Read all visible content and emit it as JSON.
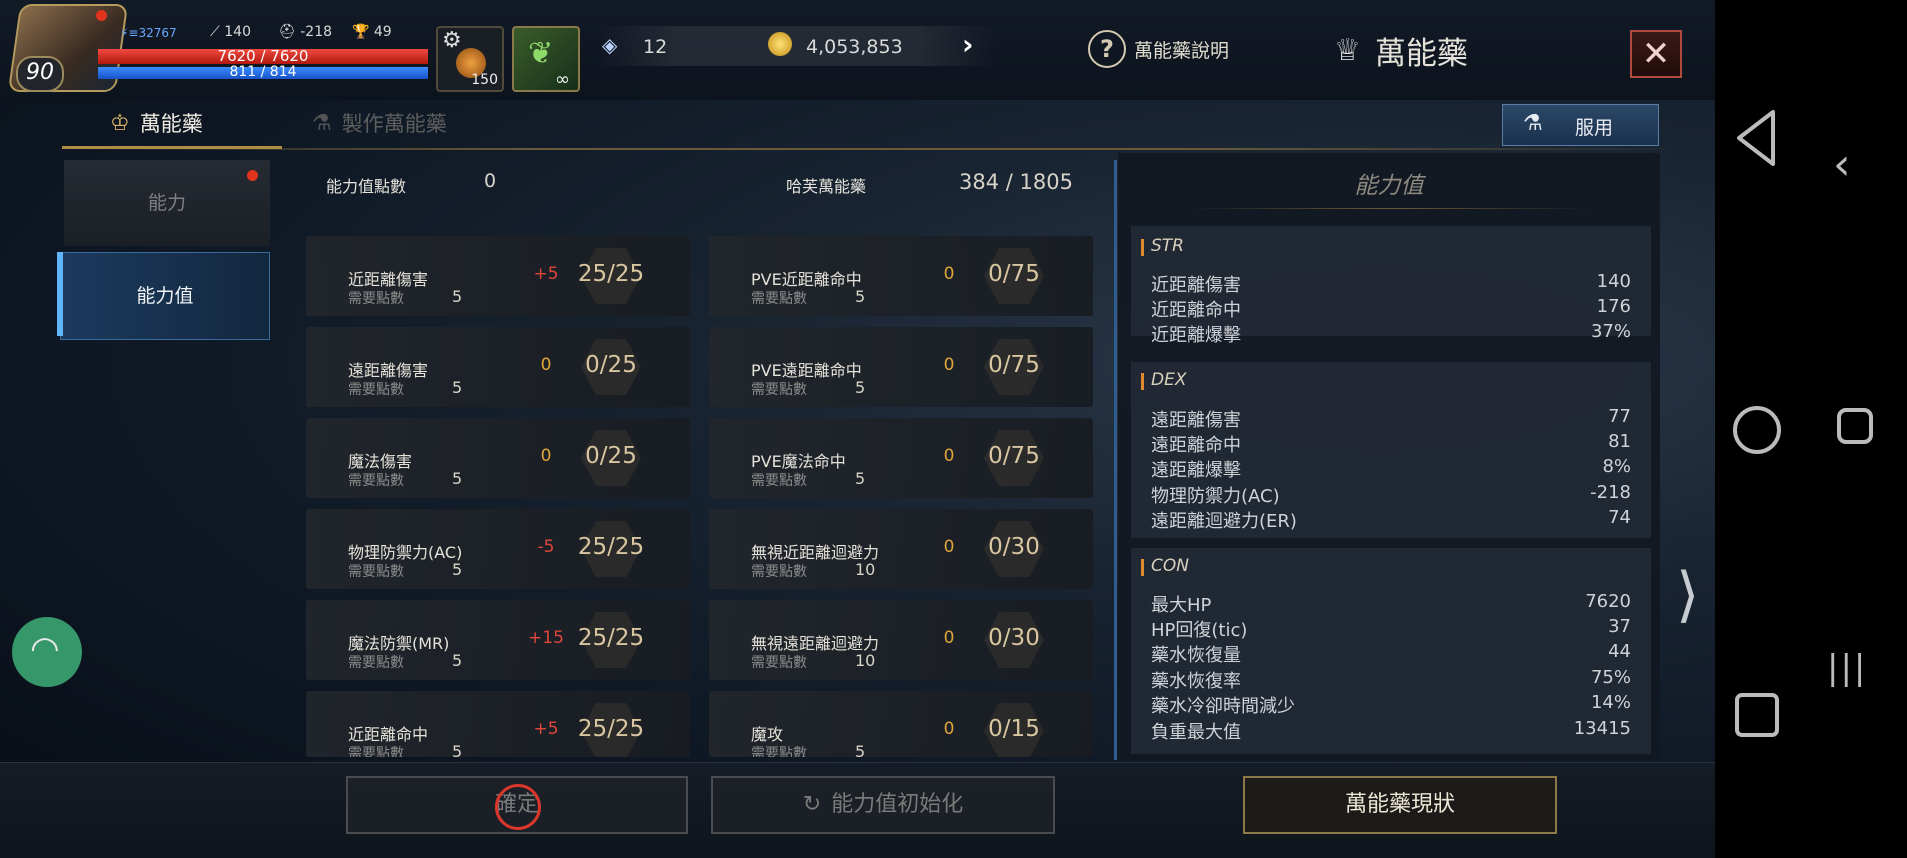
{
  "player": {
    "level": "90",
    "power": "32767",
    "attack": "140",
    "defense": "-218",
    "trophy": "49",
    "hp": "7620 / 7620",
    "mp": "811 / 814"
  },
  "items": [
    {
      "name": "potion-item",
      "count": "150"
    },
    {
      "name": "leaf-item",
      "count": "∞"
    }
  ],
  "resources": {
    "gem": "12",
    "gold": "4,053,853"
  },
  "header": {
    "help_label": "萬能藥說明",
    "title": "萬能藥"
  },
  "tabs": [
    {
      "label": "萬能藥",
      "active": true
    },
    {
      "label": "製作萬能藥",
      "active": false
    }
  ],
  "use_button": "服用",
  "left_menu": [
    {
      "label": "能力",
      "active": false,
      "badge": true
    },
    {
      "label": "能力值",
      "active": true,
      "badge": false
    }
  ],
  "points": {
    "label": "能力值點數",
    "value": "0"
  },
  "elixir": {
    "label": "哈芙萬能藥",
    "value": "384 / 1805"
  },
  "req_label": "需要點數",
  "stats_left": [
    {
      "name": "近距離傷害",
      "delta": "+5",
      "req": "5",
      "progress": "25/25"
    },
    {
      "name": "遠距離傷害",
      "delta": "0",
      "req": "5",
      "progress": "0/25"
    },
    {
      "name": "魔法傷害",
      "delta": "0",
      "req": "5",
      "progress": "0/25"
    },
    {
      "name": "物理防禦力(AC)",
      "delta": "-5",
      "req": "5",
      "progress": "25/25"
    },
    {
      "name": "魔法防禦(MR)",
      "delta": "+15",
      "req": "5",
      "progress": "25/25"
    },
    {
      "name": "近距離命中",
      "delta": "+5",
      "req": "5",
      "progress": "25/25"
    }
  ],
  "stats_right": [
    {
      "name": "PVE近距離命中",
      "delta": "0",
      "req": "5",
      "progress": "0/75"
    },
    {
      "name": "PVE遠距離命中",
      "delta": "0",
      "req": "5",
      "progress": "0/75"
    },
    {
      "name": "PVE魔法命中",
      "delta": "0",
      "req": "5",
      "progress": "0/75"
    },
    {
      "name": "無視近距離迴避力",
      "delta": "0",
      "req": "10",
      "progress": "0/30"
    },
    {
      "name": "無視遠距離迴避力",
      "delta": "0",
      "req": "10",
      "progress": "0/30"
    },
    {
      "name": "魔攻",
      "delta": "0",
      "req": "5",
      "progress": "0/15"
    }
  ],
  "panel": {
    "title": "能力值",
    "sections": [
      {
        "name": "STR",
        "rows": [
          {
            "label": "近距離傷害",
            "value": "140"
          },
          {
            "label": "近距離命中",
            "value": "176"
          },
          {
            "label": "近距離爆擊",
            "value": "37%"
          }
        ]
      },
      {
        "name": "DEX",
        "rows": [
          {
            "label": "遠距離傷害",
            "value": "77"
          },
          {
            "label": "遠距離命中",
            "value": "81"
          },
          {
            "label": "遠距離爆擊",
            "value": "8%"
          },
          {
            "label": "物理防禦力(AC)",
            "value": "-218"
          },
          {
            "label": "遠距離迴避力(ER)",
            "value": "74"
          }
        ]
      },
      {
        "name": "CON",
        "rows": [
          {
            "label": "最大HP",
            "value": "7620"
          },
          {
            "label": "HP回復(tic)",
            "value": "37"
          },
          {
            "label": "藥水恢復量",
            "value": "44"
          },
          {
            "label": "藥水恢復率",
            "value": "75%"
          },
          {
            "label": "藥水冷卻時間減少",
            "value": "14%"
          },
          {
            "label": "負重最大值",
            "value": "13415"
          }
        ]
      }
    ]
  },
  "bottom": {
    "confirm": "確定",
    "reset": "能力值初始化",
    "status": "萬能藥現狀"
  },
  "colors": {
    "positive": "#e0463a",
    "neutral": "#e0a53a",
    "accent": "#b08d45"
  }
}
